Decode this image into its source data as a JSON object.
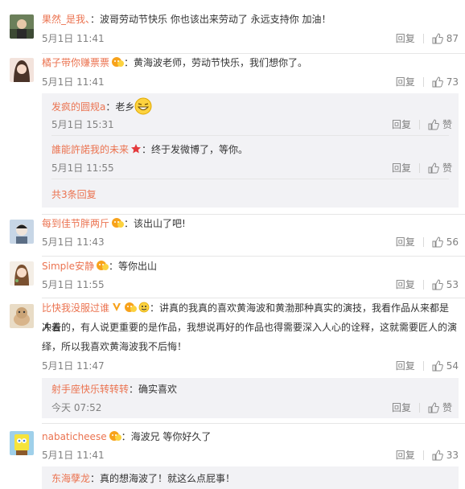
{
  "comments": [
    {
      "user": "果然_是我、",
      "text": "：波哥劳动节快乐 你也该出来劳动了 永远支持你 加油！",
      "time": "5月1日 11:41",
      "reply": "回复",
      "likes": "87"
    },
    {
      "user": "橘子带你赚票票",
      "text": "：黄海波老师，劳动节快乐，我们想你了。",
      "time": "5月1日 11:41",
      "reply": "回复",
      "likes": "73",
      "replies": [
        {
          "user": "发疯的圆规a",
          "text": "：老乡",
          "time": "5月1日 15:31",
          "reply": "回复",
          "like": "赞"
        },
        {
          "user": "誰能許諾我的未来",
          "text": "：终于发微博了，等你。",
          "time": "5月1日 11:55",
          "reply": "回复",
          "like": "赞"
        }
      ],
      "more": "共3条回复"
    },
    {
      "user": "每到佳节胖两斤",
      "text": "：该出山了吧!",
      "time": "5月1日 11:43",
      "reply": "回复",
      "likes": "56"
    },
    {
      "user": "Simple安静",
      "text": "：等你出山",
      "time": "5月1日 11:55",
      "reply": "回复",
      "likes": "53"
    },
    {
      "user": "比快我没服过谁",
      "text_line1": "：讲真的我真的喜欢黄海波和黄渤那种真实的演技，我看作品从来都是冲着",
      "text_line2": "人去的，有人说更重要的是作品，我想说再好的作品也得需要深入人心的诠释，这就需要匠人的演",
      "text_line3": "绎，所以我喜欢黄海波我不后悔！",
      "time": "5月1日 11:47",
      "reply": "回复",
      "likes": "54",
      "replies": [
        {
          "user": "射手座快乐转转转",
          "text": "：确实喜欢",
          "time": "今天 07:52",
          "reply": "回复",
          "like": "赞"
        }
      ]
    },
    {
      "user": "nabaticheese",
      "text": "：海波兄 等你好久了",
      "time": "5月1日 11:41",
      "reply": "回复",
      "likes": "33",
      "replies": [
        {
          "user": "东海孽龙",
          "text": "：真的想海波了！就这么点屁事！"
        }
      ]
    }
  ],
  "colors": {
    "username": "#eb7350",
    "meta": "#808080",
    "reply_bg": "#f2f2f5"
  }
}
